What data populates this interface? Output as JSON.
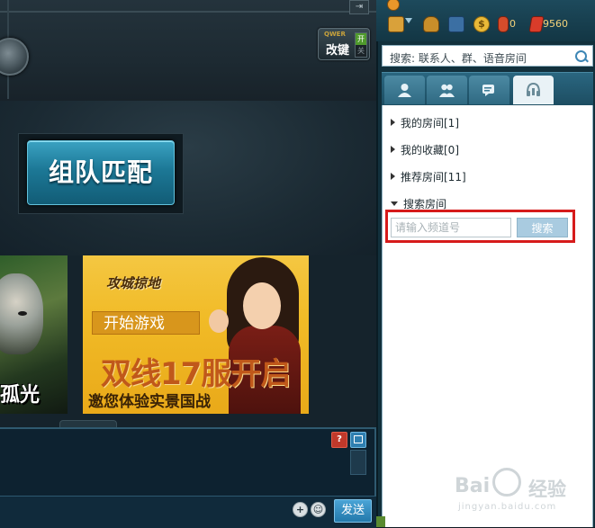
{
  "game": {
    "hotkey": {
      "top": "QWER",
      "label": "改键",
      "on": "开",
      "off": "关"
    },
    "match_button": "组队匹配",
    "banner_left_text": "孤光",
    "banner_ad": {
      "logo": "攻城掠地",
      "start": "开始游戏",
      "headline": "双线17服开启",
      "subline": "邀您体验实景国战"
    },
    "help_label": "?",
    "send_label": "发送"
  },
  "right_panel": {
    "status": {
      "gourd_count": "0",
      "gem_count": "9560"
    },
    "search_placeholder": "搜索: 联系人、群、语音房间",
    "groups": [
      {
        "label": "我的房间[1]",
        "expanded": false
      },
      {
        "label": "我的收藏[0]",
        "expanded": false
      },
      {
        "label": "推荐房间[11]",
        "expanded": false
      },
      {
        "label": "搜索房间",
        "expanded": true
      }
    ],
    "channel_input_placeholder": "请输入频道号",
    "search_button": "搜索"
  },
  "watermark": {
    "brand": "Bai",
    "suffix": "经验",
    "url": "jingyan.baidu.com"
  },
  "colors": {
    "accent": "#1c7896",
    "highlight": "#d61b1b",
    "panel": "#12303c"
  }
}
